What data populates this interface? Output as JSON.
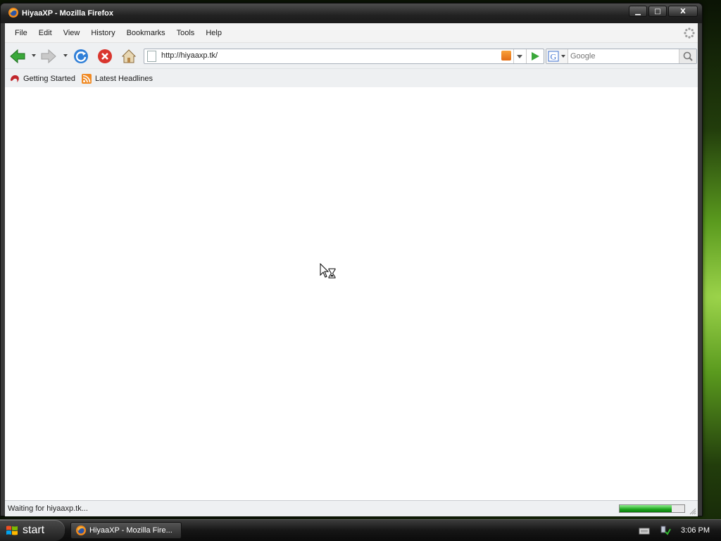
{
  "window": {
    "title": "HiyaaXP - Mozilla Firefox",
    "controls": {
      "minimize": "▁",
      "maximize": "□",
      "close": "X"
    }
  },
  "menu": [
    "File",
    "Edit",
    "View",
    "History",
    "Bookmarks",
    "Tools",
    "Help"
  ],
  "navigation": {
    "url": "http://hiyaaxp.tk/",
    "search_placeholder": "Google",
    "search_engine_letter": "G"
  },
  "bookmarks": [
    {
      "label": "Getting Started",
      "icon": "firefox-icon"
    },
    {
      "label": "Latest Headlines",
      "icon": "rss-icon"
    }
  ],
  "status": {
    "text": "Waiting for hiyaaxp.tk...",
    "progress": 0.8
  },
  "taskbar": {
    "start_label": "start",
    "task_label": "HiyaaXP - Mozilla Fire...",
    "clock": "3:06 PM"
  },
  "colors": {
    "progress": "#1ea51e",
    "feed": "#f08a24",
    "stop": "#d9362e",
    "reload": "#2f7fd8",
    "back": "#3aa83a"
  }
}
